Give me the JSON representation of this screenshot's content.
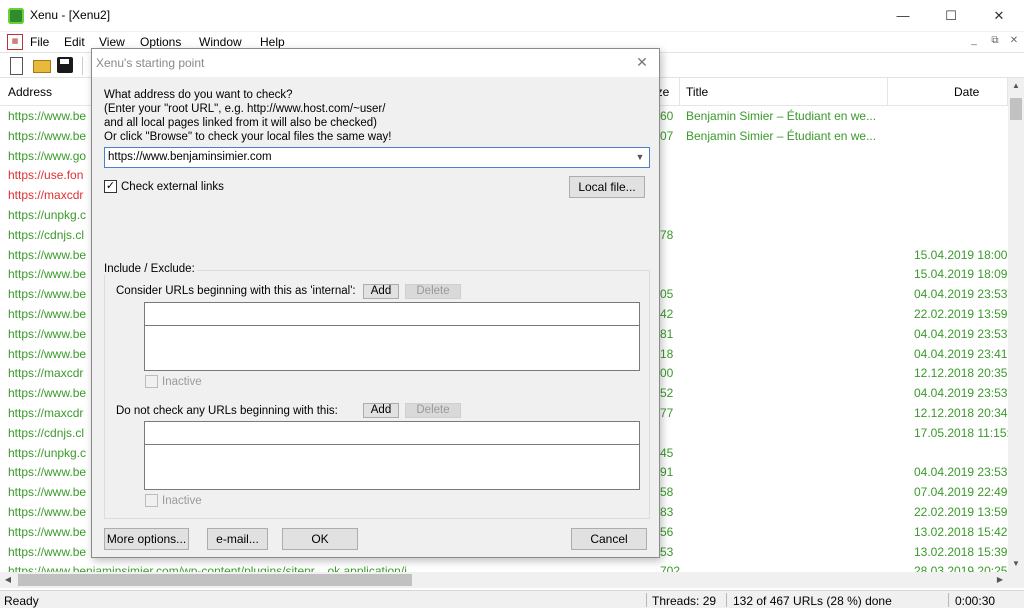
{
  "window": {
    "title": "Xenu - [Xenu2]",
    "controls": [
      "—",
      "☐",
      "✕"
    ]
  },
  "menubar": {
    "items": [
      "File",
      "Edit",
      "View",
      "Options",
      "Window",
      "Help"
    ],
    "mdi_controls": [
      "_",
      "⧉",
      "✕"
    ]
  },
  "grid": {
    "columns": {
      "address": "Address",
      "size": "ize",
      "title": "Title",
      "date": "Date"
    },
    "rows": [
      {
        "address": "https://www.be",
        "size": "60",
        "title": "Benjamin Simier – Étudiant en we...",
        "date": "",
        "status": "ok"
      },
      {
        "address": "https://www.be",
        "size": "07",
        "title": "Benjamin Simier – Étudiant en we...",
        "date": "",
        "status": "ok"
      },
      {
        "address": "https://www.go",
        "size": "",
        "title": "",
        "date": "",
        "status": "ok"
      },
      {
        "address": "https://use.fon",
        "size": "",
        "title": "",
        "date": "",
        "status": "err"
      },
      {
        "address": "https://maxcdr",
        "size": "",
        "title": "",
        "date": "",
        "status": "err"
      },
      {
        "address": "https://unpkg.c",
        "size": "",
        "title": "",
        "date": "",
        "status": "ok"
      },
      {
        "address": "https://cdnjs.cl",
        "size": "78",
        "title": "",
        "date": "",
        "status": "ok"
      },
      {
        "address": "https://www.be",
        "size": "",
        "title": "",
        "date": "15.04.2019  18:00:",
        "status": "ok"
      },
      {
        "address": "https://www.be",
        "size": "",
        "title": "",
        "date": "15.04.2019  18:09:",
        "status": "ok"
      },
      {
        "address": "https://www.be",
        "size": "05",
        "title": "",
        "date": "04.04.2019  23:53:",
        "status": "ok"
      },
      {
        "address": "https://www.be",
        "size": "42",
        "title": "",
        "date": "22.02.2019  13:59:",
        "status": "ok"
      },
      {
        "address": "https://www.be",
        "size": "81",
        "title": "",
        "date": "04.04.2019  23:53:",
        "status": "ok"
      },
      {
        "address": "https://www.be",
        "size": "18",
        "title": "",
        "date": "04.04.2019  23:41:",
        "status": "ok"
      },
      {
        "address": "https://maxcdr",
        "size": "00",
        "title": "",
        "date": "12.12.2018  20:35:",
        "status": "ok"
      },
      {
        "address": "https://www.be",
        "size": "52",
        "title": "",
        "date": "04.04.2019  23:53:",
        "status": "ok"
      },
      {
        "address": "https://maxcdr",
        "size": "77",
        "title": "",
        "date": "12.12.2018  20:34:",
        "status": "ok"
      },
      {
        "address": "https://cdnjs.cl",
        "size": "",
        "title": "",
        "date": "17.05.2018  11:15:",
        "status": "ok"
      },
      {
        "address": "https://unpkg.c",
        "size": "45",
        "title": "",
        "date": "",
        "status": "ok"
      },
      {
        "address": "https://www.be",
        "size": "91",
        "title": "",
        "date": "04.04.2019  23:53:",
        "status": "ok"
      },
      {
        "address": "https://www.be",
        "size": "58",
        "title": "",
        "date": "07.04.2019  22:49:",
        "status": "ok"
      },
      {
        "address": "https://www.be",
        "size": "83",
        "title": "",
        "date": "22.02.2019  13:59:",
        "status": "ok"
      },
      {
        "address": "https://www.be",
        "size": "56",
        "title": "",
        "date": "13.02.2018  15:42:",
        "status": "ok"
      },
      {
        "address": "https://www.be",
        "size": "53",
        "title": "",
        "date": "13.02.2018  15:39:",
        "status": "ok"
      },
      {
        "address": "https://www.benjaminsimier.com/wp-content/plugins/sitepr...     ok                    application/j",
        "size": "702",
        "title": "",
        "date": "28.03.2019  20:25:",
        "status": "ok"
      }
    ]
  },
  "statusbar": {
    "ready": "Ready",
    "threads": "Threads: 29",
    "progress": "132 of 467 URLs (28 %) done",
    "elapsed": "0:00:30"
  },
  "dialog": {
    "title": "Xenu's starting point",
    "prompt_lines": [
      "What address do you want to check?",
      "(Enter your \"root URL\", e.g. http://www.host.com/~user/",
      "and all local pages linked from it will also be checked)",
      "Or click \"Browse\" to check your local files the same way!"
    ],
    "url_value": "https://www.benjaminsimier.com",
    "check_external_label": "Check external links",
    "check_external_checked": "✓",
    "local_file_button": "Local file...",
    "include_exclude_label": "Include / Exclude:",
    "internal_label": "Consider URLs beginning with this as 'internal':",
    "exclude_label": "Do not check any URLs beginning with this:",
    "add_label": "Add",
    "delete_label": "Delete",
    "inactive_label": "Inactive",
    "more_options_button": "More options...",
    "email_button": "e-mail...",
    "ok_button": "OK",
    "cancel_button": "Cancel"
  }
}
